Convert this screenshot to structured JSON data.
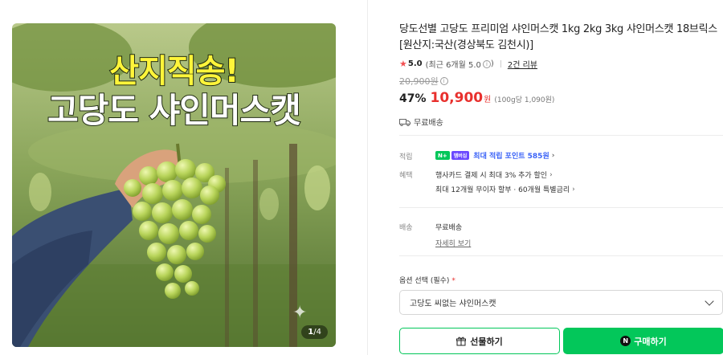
{
  "gallery": {
    "headline_line1": "산지직송!",
    "headline_line2": "고당도 샤인머스캣",
    "counter_current": "1",
    "counter_total": "/4"
  },
  "product": {
    "title": "당도선별 고당도 프리미엄 샤인머스캣 1kg 2kg 3kg 샤인머스캣 18브릭스 [원산지:국산(경상북도 김천시)]",
    "rating": {
      "star_icon": "star-icon",
      "score": "5.0",
      "recent": "(최근 6개월 5.0",
      "recent_info": "i",
      "recent_close": ")",
      "review_link": "2건 리뷰"
    },
    "original_price": "20,900원",
    "discount": "47%",
    "sale_price": "10,900",
    "sale_unit": "원",
    "per_100g": "(100g당 1,090원)",
    "shipping": "무료배송"
  },
  "benefits": {
    "points_label": "적립",
    "badge_n": "N+",
    "badge_membership": "멤버십",
    "points_text": "최대 적립 포인트 585원",
    "benefit_label": "혜택",
    "card_text": "행사카드 결제 시 최대 3% 추가 할인",
    "installment_text": "최대 12개월 무이자 할부 · 60개월 특별금리"
  },
  "delivery": {
    "label": "배송",
    "value": "무료배송",
    "details_link": "자세히 보기"
  },
  "options": {
    "label": "옵션 선택 (필수)",
    "required_mark": "*",
    "selected": "고당도 씨없는 샤인머스캣"
  },
  "actions": {
    "gift_label": "선물하기",
    "buy_label": "구매하기",
    "npay_glyph": "N"
  },
  "colors": {
    "accent_green": "#03c75a",
    "sale_red": "#e8302d",
    "points_blue": "#3b63f7"
  }
}
